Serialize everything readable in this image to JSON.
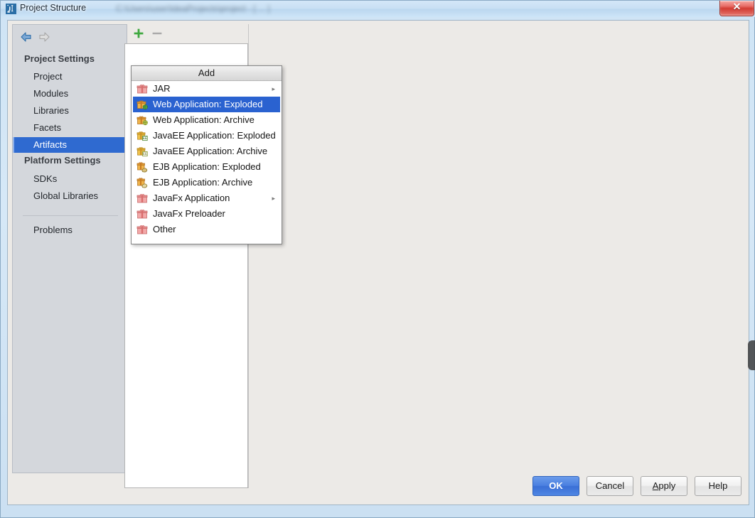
{
  "window": {
    "title": "Project Structure",
    "title_blur_text": "C:\\Users\\user\\IdeaProjects\\project - [ ... ]",
    "close_label": "✕",
    "app_icon_name": "intellij-idea-icon"
  },
  "nav": {
    "back_label": "←",
    "forward_label": "→"
  },
  "sidebar": {
    "groups": [
      {
        "label": "Project Settings"
      },
      {
        "label": "Platform Settings"
      }
    ],
    "items": [
      {
        "label": "Project",
        "selected": false
      },
      {
        "label": "Modules",
        "selected": false
      },
      {
        "label": "Libraries",
        "selected": false
      },
      {
        "label": "Facets",
        "selected": false
      },
      {
        "label": "Artifacts",
        "selected": true
      },
      {
        "label": "SDKs",
        "selected": false
      },
      {
        "label": "Global Libraries",
        "selected": false
      },
      {
        "label": "Problems",
        "selected": false
      }
    ]
  },
  "toolbar": {
    "add_label": "+",
    "remove_label": "−",
    "add_icon": "plus-icon",
    "remove_icon": "minus-icon"
  },
  "add_menu": {
    "header": "Add",
    "items": [
      {
        "label": "JAR",
        "icon": "jar-package-icon",
        "selected": false,
        "submenu": true
      },
      {
        "label": "Web Application: Exploded",
        "icon": "web-exploded-icon",
        "selected": true,
        "submenu": false
      },
      {
        "label": "Web Application: Archive",
        "icon": "web-archive-icon",
        "selected": false,
        "submenu": false
      },
      {
        "label": "JavaEE Application: Exploded",
        "icon": "javaee-exploded-icon",
        "selected": false,
        "submenu": false
      },
      {
        "label": "JavaEE Application: Archive",
        "icon": "javaee-archive-icon",
        "selected": false,
        "submenu": false
      },
      {
        "label": "EJB Application: Exploded",
        "icon": "ejb-exploded-icon",
        "selected": false,
        "submenu": false
      },
      {
        "label": "EJB Application: Archive",
        "icon": "ejb-archive-icon",
        "selected": false,
        "submenu": false
      },
      {
        "label": "JavaFx Application",
        "icon": "javafx-package-icon",
        "selected": false,
        "submenu": true
      },
      {
        "label": "JavaFx Preloader",
        "icon": "javafx-package-icon",
        "selected": false,
        "submenu": false
      },
      {
        "label": "Other",
        "icon": "other-package-icon",
        "selected": false,
        "submenu": false
      }
    ],
    "submenu_arrow": "▸"
  },
  "buttons": {
    "ok": "OK",
    "cancel": "Cancel",
    "apply_prefix": "A",
    "apply_rest": "pply",
    "help": "Help"
  },
  "colors": {
    "selection_blue": "#2a62d0",
    "sidebar_selection_blue": "#2f6ad0",
    "primary_button_blue": "#4a80e0",
    "close_red": "#d23c33",
    "titlebar_blue": "#c9e0f4"
  }
}
